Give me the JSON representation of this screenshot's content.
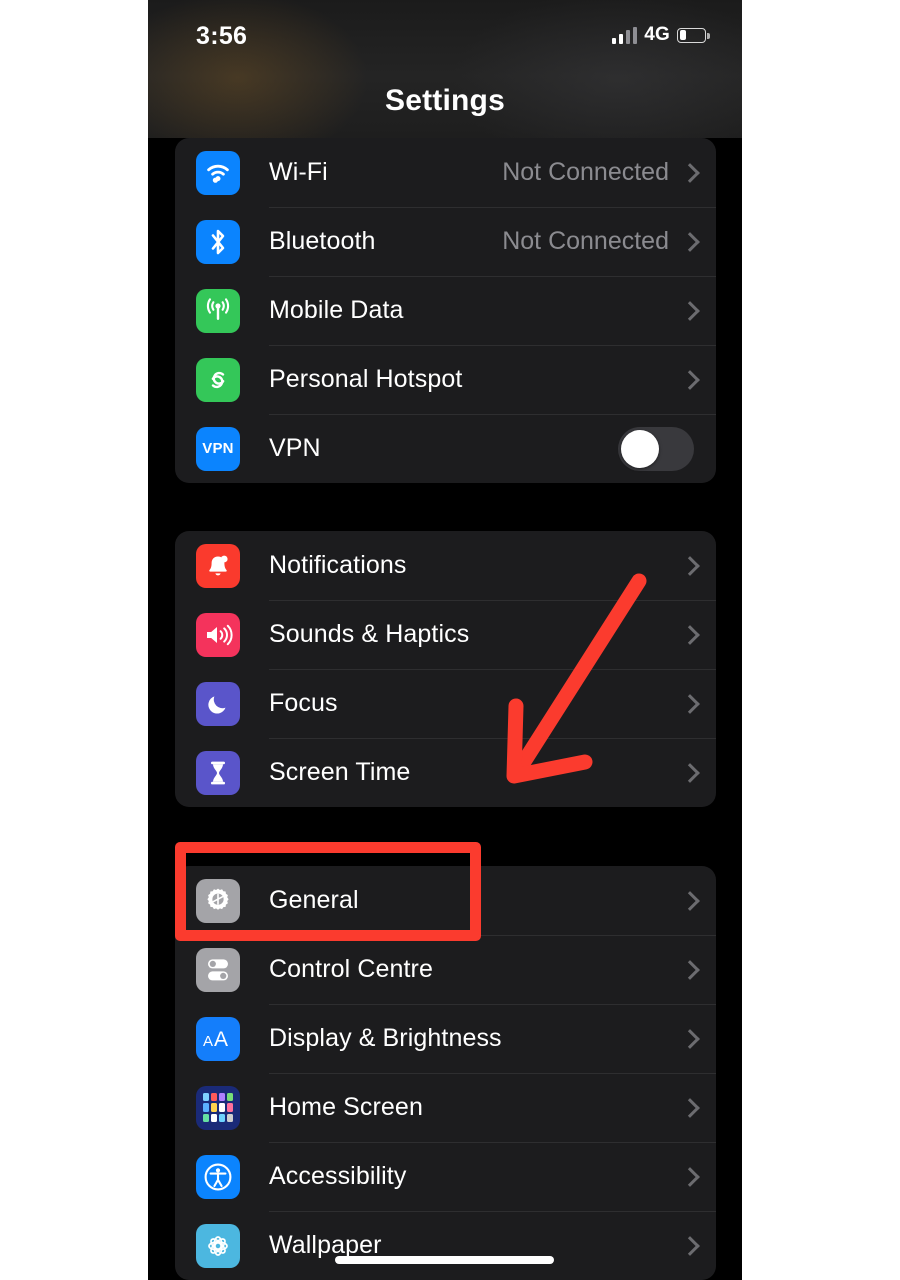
{
  "status_bar": {
    "time": "3:56",
    "network_label": "4G",
    "signal_icon": "signal-bars-icon",
    "battery_icon": "battery-low-icon",
    "battery_level_percent": 26
  },
  "header": {
    "title": "Settings"
  },
  "groups": [
    {
      "id": "connectivity",
      "rows": [
        {
          "label": "Wi-Fi",
          "value": "Not Connected",
          "icon": "wifi-icon",
          "accessory": "chevron"
        },
        {
          "label": "Bluetooth",
          "value": "Not Connected",
          "icon": "bluetooth-icon",
          "accessory": "chevron"
        },
        {
          "label": "Mobile Data",
          "value": "",
          "icon": "cellular-icon",
          "accessory": "chevron"
        },
        {
          "label": "Personal Hotspot",
          "value": "",
          "icon": "hotspot-icon",
          "accessory": "chevron"
        },
        {
          "label": "VPN",
          "value": "",
          "icon": "vpn-icon",
          "accessory": "toggle",
          "toggle_on": false
        }
      ]
    },
    {
      "id": "notifications",
      "rows": [
        {
          "label": "Notifications",
          "value": "",
          "icon": "bell-icon",
          "accessory": "chevron"
        },
        {
          "label": "Sounds & Haptics",
          "value": "",
          "icon": "speaker-icon",
          "accessory": "chevron"
        },
        {
          "label": "Focus",
          "value": "",
          "icon": "moon-icon",
          "accessory": "chevron"
        },
        {
          "label": "Screen Time",
          "value": "",
          "icon": "hourglass-icon",
          "accessory": "chevron"
        }
      ]
    },
    {
      "id": "general",
      "rows": [
        {
          "label": "General",
          "value": "",
          "icon": "gear-icon",
          "accessory": "chevron",
          "highlighted": true
        },
        {
          "label": "Control Centre",
          "value": "",
          "icon": "toggles-icon",
          "accessory": "chevron"
        },
        {
          "label": "Display & Brightness",
          "value": "",
          "icon": "text-size-icon",
          "accessory": "chevron"
        },
        {
          "label": "Home Screen",
          "value": "",
          "icon": "app-grid-icon",
          "accessory": "chevron"
        },
        {
          "label": "Accessibility",
          "value": "",
          "icon": "accessibility-icon",
          "accessory": "chevron"
        },
        {
          "label": "Wallpaper",
          "value": "",
          "icon": "flower-icon",
          "accessory": "chevron"
        }
      ]
    }
  ],
  "annotations": {
    "arrow": {
      "name": "red-arrow-annotation",
      "color": "#fb3b2e",
      "points_to": "Screen Time"
    },
    "highlight_box": {
      "name": "red-highlight-box-annotation",
      "color": "#fb3b2e",
      "surrounds": "General"
    }
  },
  "colors": {
    "device_background": "#000000",
    "card_background": "#1c1c1e",
    "primary_text": "#ffffff",
    "secondary_text": "#8b8b90",
    "annotation_red": "#fb3b2e",
    "wifi_blue": "#0b84fe",
    "cellular_green": "#34c759",
    "notification_red": "#fa3a2d",
    "focus_indigo": "#5a55ca",
    "general_gray": "#a4a4a8"
  },
  "vpn_badge_text": "VPN",
  "home_indicator": "home-indicator-bar"
}
